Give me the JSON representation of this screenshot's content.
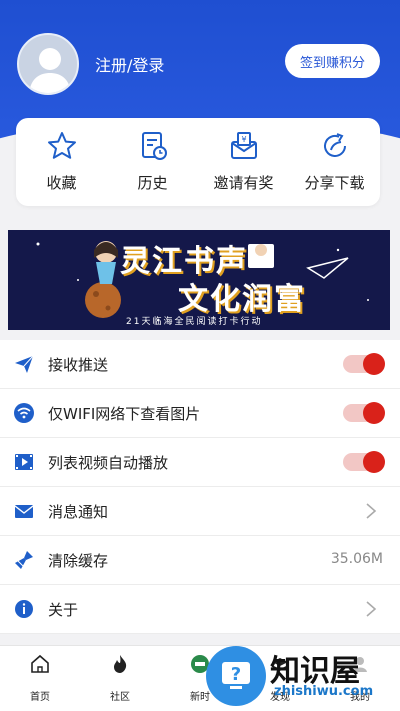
{
  "header": {
    "login_label": "注册/登录",
    "checkin_label": "签到赚积分"
  },
  "quick": [
    {
      "icon": "star-icon",
      "label": "收藏"
    },
    {
      "icon": "history-icon",
      "label": "历史"
    },
    {
      "icon": "invite-icon",
      "label": "邀请有奖"
    },
    {
      "icon": "share-icon",
      "label": "分享下载"
    }
  ],
  "banner": {
    "line1": "灵江书声",
    "line2": "文化润富",
    "line3": "21天临海全民阅读打卡行动"
  },
  "settings": [
    {
      "icon": "send-icon",
      "label": "接收推送",
      "control": "toggle",
      "on": true
    },
    {
      "icon": "wifi-icon",
      "label": "仅WIFI网络下查看图片",
      "control": "toggle",
      "on": true
    },
    {
      "icon": "video-icon",
      "label": "列表视频自动播放",
      "control": "toggle",
      "on": true
    },
    {
      "icon": "mail-icon",
      "label": "消息通知",
      "control": "chevron"
    },
    {
      "icon": "broom-icon",
      "label": "清除缓存",
      "control": "value",
      "value": "35.06M"
    },
    {
      "icon": "info-icon",
      "label": "关于",
      "control": "chevron"
    }
  ],
  "tabs": [
    {
      "icon": "home-icon",
      "label": "首页"
    },
    {
      "icon": "fire-icon",
      "label": "社区"
    },
    {
      "icon": "news-icon",
      "label": "新时"
    },
    {
      "icon": "discover-icon",
      "label": "发现"
    },
    {
      "icon": "me-icon",
      "label": "我的"
    }
  ],
  "watermark": {
    "zh": "知识屋",
    "en": "zhishiwu.com"
  },
  "colors": {
    "brand": "#2a5be0",
    "accent": "#d9221a",
    "icon": "#1f5fc9"
  }
}
